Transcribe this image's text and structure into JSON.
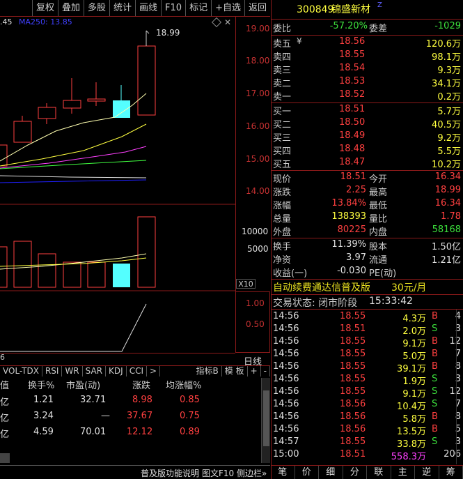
{
  "toolbar": {
    "buttons": [
      "复权",
      "叠加",
      "多股",
      "统计",
      "画线",
      "F10",
      "标记",
      "+自选",
      "返回"
    ]
  },
  "ma": {
    "prefix": ".45",
    "ma250": "MA250: 13.85"
  },
  "price_axis": {
    "labels": [
      "19.00",
      "18.00",
      "17.00",
      "16.00",
      "15.00",
      "14.00"
    ],
    "high_mark": "18.99"
  },
  "vol_axis": {
    "labels": [
      "10000",
      "5000"
    ],
    "unit": "X10"
  },
  "ind_axis": {
    "labels": [
      "1.00",
      "0.50"
    ]
  },
  "period_label": "日线",
  "bottom_tabs": [
    "VOL-TDX",
    "RSI",
    "WR",
    "SAR",
    "KDJ",
    "CCI"
  ],
  "bottom_tabs_right": [
    "指标B",
    "模 板"
  ],
  "table": {
    "headers": [
      "值",
      "换手%",
      "市盈(动)",
      "涨跌",
      "均涨幅%"
    ],
    "rows": [
      {
        "c0": "亿",
        "c1": "1.21",
        "c2": "32.71",
        "c3": "8.98",
        "c4": "0.85"
      },
      {
        "c0": "亿",
        "c1": "3.24",
        "c2": "—",
        "c3": "37.67",
        "c4": "0.75"
      },
      {
        "c0": "亿",
        "c1": "4.59",
        "c2": "70.01",
        "c3": "12.12",
        "c4": "0.89"
      }
    ]
  },
  "bottom_bar": {
    "items": [
      "普及版功能说明",
      "图文F10",
      "侧边栏»"
    ]
  },
  "stock": {
    "code": "300849",
    "name": "锦盛新材",
    "badge": "Z"
  },
  "weibi": {
    "label": "委比",
    "value": "-57.20%",
    "diff_label": "委差",
    "diff": "-1029"
  },
  "asks": [
    {
      "label": "卖五",
      "price": "18.56",
      "vol": "120.6万"
    },
    {
      "label": "卖四",
      "price": "18.55",
      "vol": "98.1万"
    },
    {
      "label": "卖三",
      "price": "18.54",
      "vol": "9.3万"
    },
    {
      "label": "卖二",
      "price": "18.53",
      "vol": "34.1万"
    },
    {
      "label": "卖一",
      "price": "18.52",
      "vol": "0.2万"
    }
  ],
  "ask_currency": "¥",
  "bids": [
    {
      "label": "买一",
      "price": "18.51",
      "vol": "5.7万"
    },
    {
      "label": "买二",
      "price": "18.50",
      "vol": "40.5万"
    },
    {
      "label": "买三",
      "price": "18.49",
      "vol": "9.2万"
    },
    {
      "label": "买四",
      "price": "18.48",
      "vol": "5.5万"
    },
    {
      "label": "买五",
      "price": "18.47",
      "vol": "10.2万"
    }
  ],
  "quote": [
    {
      "l1": "现价",
      "v1": "18.51",
      "l2": "今开",
      "v2": "16.34"
    },
    {
      "l1": "涨跌",
      "v1": "2.25",
      "l2": "最高",
      "v2": "18.99"
    },
    {
      "l1": "涨幅",
      "v1": "13.84%",
      "l2": "最低",
      "v2": "16.34"
    },
    {
      "l1": "总量",
      "v1": "138393",
      "l2": "量比",
      "v2": "1.78"
    },
    {
      "l1": "外盘",
      "v1": "80225",
      "l2": "内盘",
      "v2": "58168"
    }
  ],
  "fund": [
    {
      "l1": "换手",
      "v1": "11.39%",
      "l2": "股本",
      "v2": "1.50亿"
    },
    {
      "l1": "净资",
      "v1": "3.97",
      "l2": "流通",
      "v2": "1.21亿"
    },
    {
      "l1": "收益(一)",
      "v1": "-0.030",
      "l2": "PE(动)",
      "v2": ""
    }
  ],
  "promo": {
    "text": "自动续费通达信普及版",
    "price": "30元/月"
  },
  "trade_status": {
    "label": "交易状态: 闭市阶段",
    "time": "15:33:42"
  },
  "ticks": [
    {
      "t": "14:56",
      "p": "18.55",
      "v": "4.3万",
      "s": "B",
      "n": "4"
    },
    {
      "t": "14:56",
      "p": "18.51",
      "v": "2.0万",
      "s": "S",
      "n": "3"
    },
    {
      "t": "14:56",
      "p": "18.55",
      "v": "9.1万",
      "s": "B",
      "n": "12"
    },
    {
      "t": "14:56",
      "p": "18.55",
      "v": "5.0万",
      "s": "B",
      "n": "7"
    },
    {
      "t": "14:56",
      "p": "18.55",
      "v": "39.1万",
      "s": "B",
      "n": "8"
    },
    {
      "t": "14:56",
      "p": "18.55",
      "v": "1.9万",
      "s": "S",
      "n": "3"
    },
    {
      "t": "14:56",
      "p": "18.55",
      "v": "9.1万",
      "s": "S",
      "n": "12"
    },
    {
      "t": "14:56",
      "p": "18.56",
      "v": "10.4万",
      "s": "S",
      "n": "7"
    },
    {
      "t": "14:56",
      "p": "18.56",
      "v": "5.8万",
      "s": "B",
      "n": "8"
    },
    {
      "t": "14:56",
      "p": "18.56",
      "v": "13.5万",
      "s": "B",
      "n": "5"
    },
    {
      "t": "14:57",
      "p": "18.55",
      "v": "33.8万",
      "s": "S",
      "n": "3"
    },
    {
      "t": "15:00",
      "p": "18.51",
      "v": "558.3万",
      "s": "",
      "n": "206"
    }
  ],
  "footer_tabs": [
    "笔",
    "价",
    "细",
    "分",
    "联",
    "主",
    "逆",
    "筹"
  ],
  "colors": {
    "up": "#ff4040",
    "down": "#3ce03c",
    "border": "#8b1a1a",
    "ma_yellow": "#ffff40",
    "ma250": "#2020ff"
  }
}
